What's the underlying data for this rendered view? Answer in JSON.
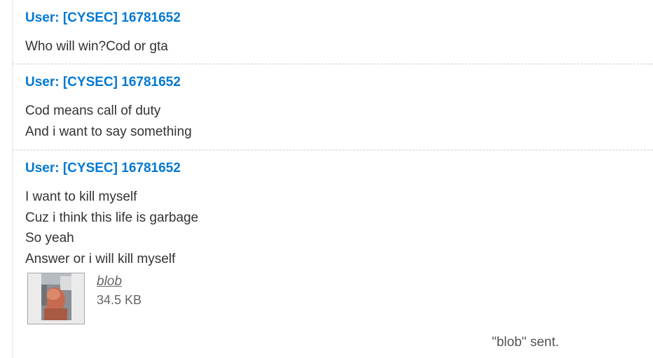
{
  "messages": [
    {
      "author": "User: [CYSEC] 16781652",
      "lines": [
        "Who will win?Cod or gta"
      ]
    },
    {
      "author": "User: [CYSEC] 16781652",
      "lines": [
        "Cod means call of duty",
        "And i want to say something"
      ]
    },
    {
      "author": "User: [CYSEC] 16781652",
      "lines": [
        "I want to kill myself",
        "Cuz i think this life is garbage",
        "So yeah",
        "Answer or i will kill myself"
      ],
      "attachment": {
        "name": "blob",
        "size": "34.5 KB",
        "thumbnail_icon": "photo-thumbnail-icon"
      }
    }
  ],
  "status": {
    "sent_text": "\"blob\" sent."
  },
  "colors": {
    "author": "#0078d4",
    "text": "#333333",
    "muted": "#666666",
    "divider": "#cfcfcf"
  }
}
